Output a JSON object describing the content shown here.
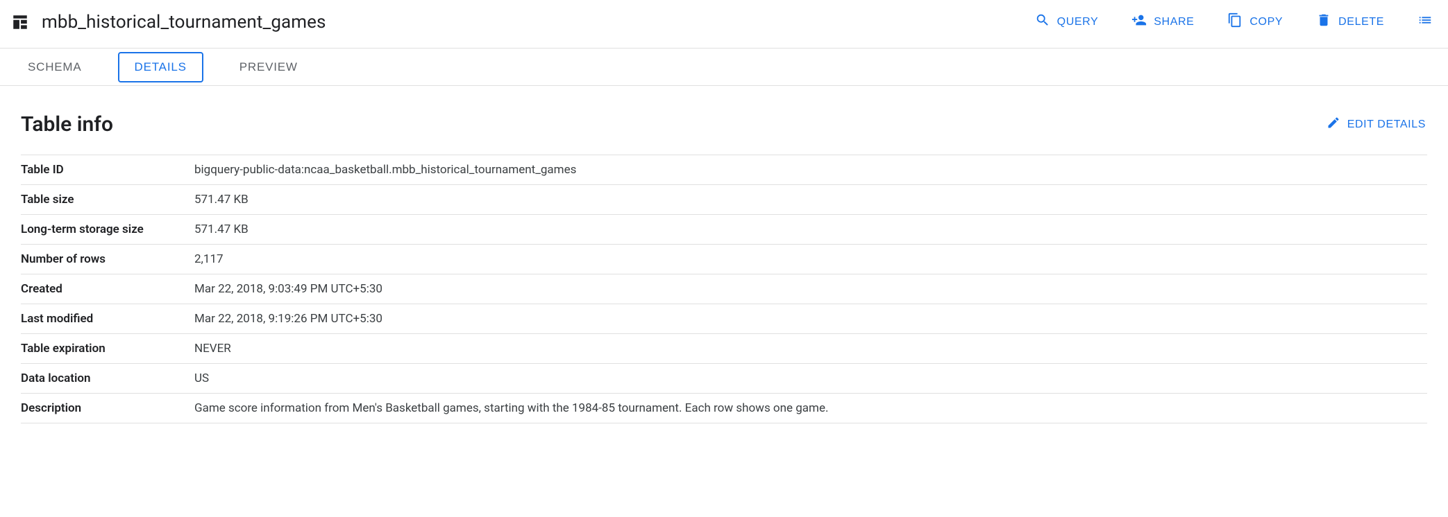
{
  "header": {
    "title": "mbb_historical_tournament_games",
    "actions": {
      "query": "QUERY",
      "share": "SHARE",
      "copy": "COPY",
      "delete": "DELETE"
    }
  },
  "tabs": {
    "schema": "SCHEMA",
    "details": "DETAILS",
    "preview": "PREVIEW"
  },
  "section": {
    "title": "Table info",
    "edit": "EDIT DETAILS"
  },
  "info": [
    {
      "key": "Table ID",
      "val": "bigquery-public-data:ncaa_basketball.mbb_historical_tournament_games"
    },
    {
      "key": "Table size",
      "val": "571.47 KB"
    },
    {
      "key": "Long-term storage size",
      "val": "571.47 KB"
    },
    {
      "key": "Number of rows",
      "val": "2,117"
    },
    {
      "key": "Created",
      "val": "Mar 22, 2018, 9:03:49 PM UTC+5:30"
    },
    {
      "key": "Last modified",
      "val": "Mar 22, 2018, 9:19:26 PM UTC+5:30"
    },
    {
      "key": "Table expiration",
      "val": "NEVER"
    },
    {
      "key": "Data location",
      "val": "US"
    },
    {
      "key": "Description",
      "val": "Game score information from Men's Basketball games, starting with the 1984-85 tournament. Each row shows one game."
    }
  ]
}
